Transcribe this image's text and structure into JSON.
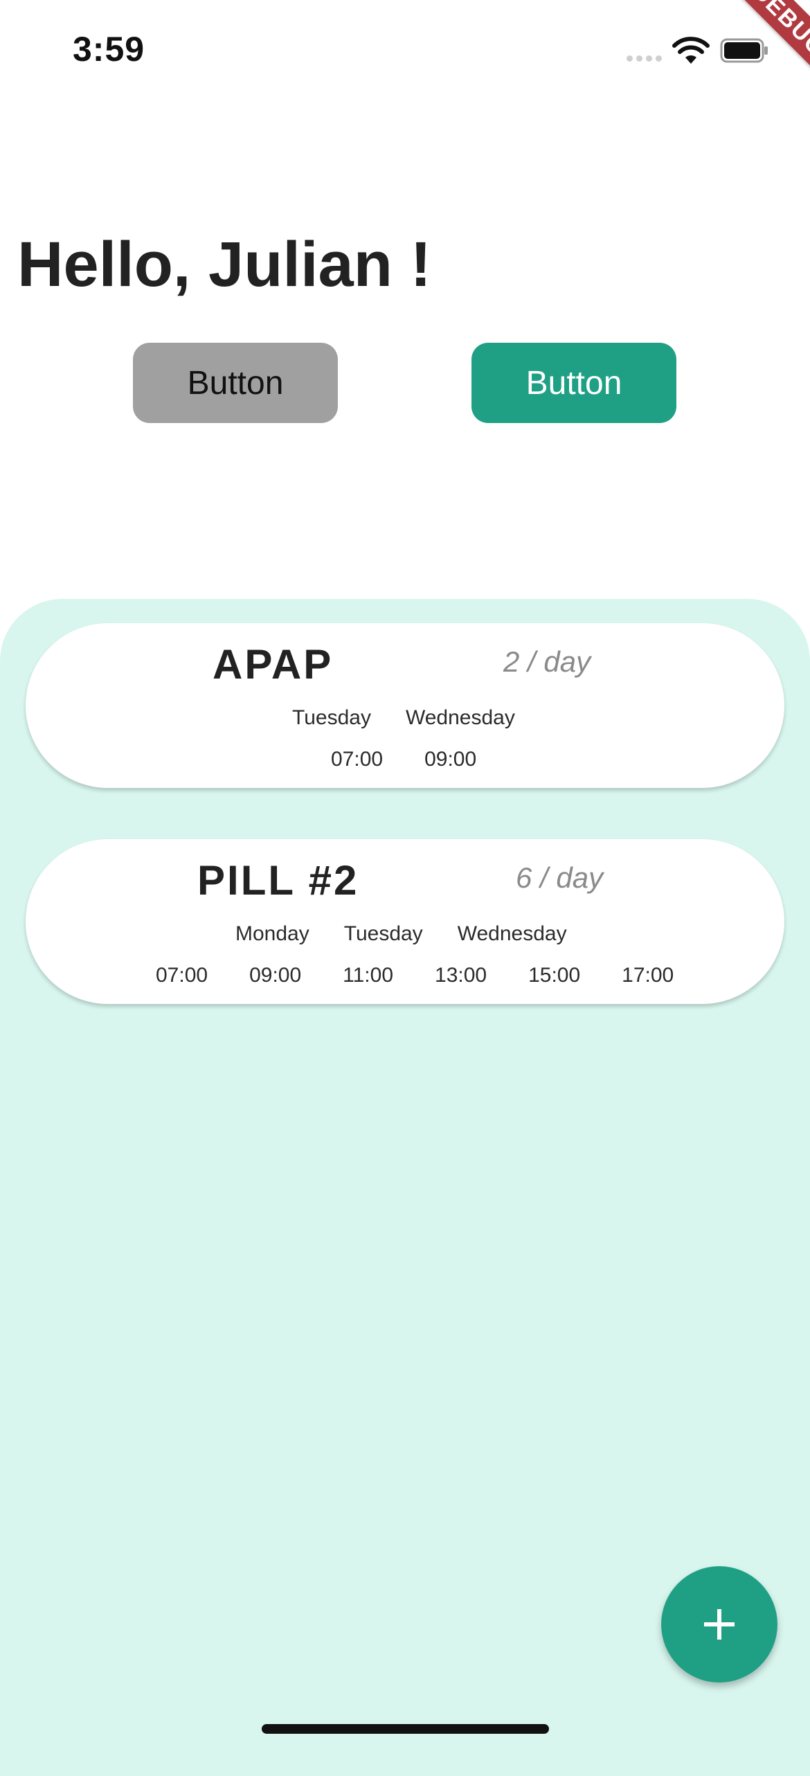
{
  "status_bar": {
    "time": "3:59"
  },
  "debug_banner": "DEBUG",
  "greeting": "Hello, Julian !",
  "buttons": [
    {
      "label": "Button"
    },
    {
      "label": "Button"
    }
  ],
  "colors": {
    "accent": "#1fa085",
    "panel": "#d8f6ee",
    "grey_button": "#a0a0a0",
    "debug": "#b03a3f"
  },
  "pills": [
    {
      "name": "APAP",
      "frequency": "2 / day",
      "days": [
        "Tuesday",
        "Wednesday"
      ],
      "times": [
        "07:00",
        "09:00"
      ]
    },
    {
      "name": "PILL #2",
      "frequency": "6 / day",
      "days": [
        "Monday",
        "Tuesday",
        "Wednesday"
      ],
      "times": [
        "07:00",
        "09:00",
        "11:00",
        "13:00",
        "15:00",
        "17:00"
      ]
    }
  ],
  "fab": {
    "icon": "plus-icon"
  }
}
